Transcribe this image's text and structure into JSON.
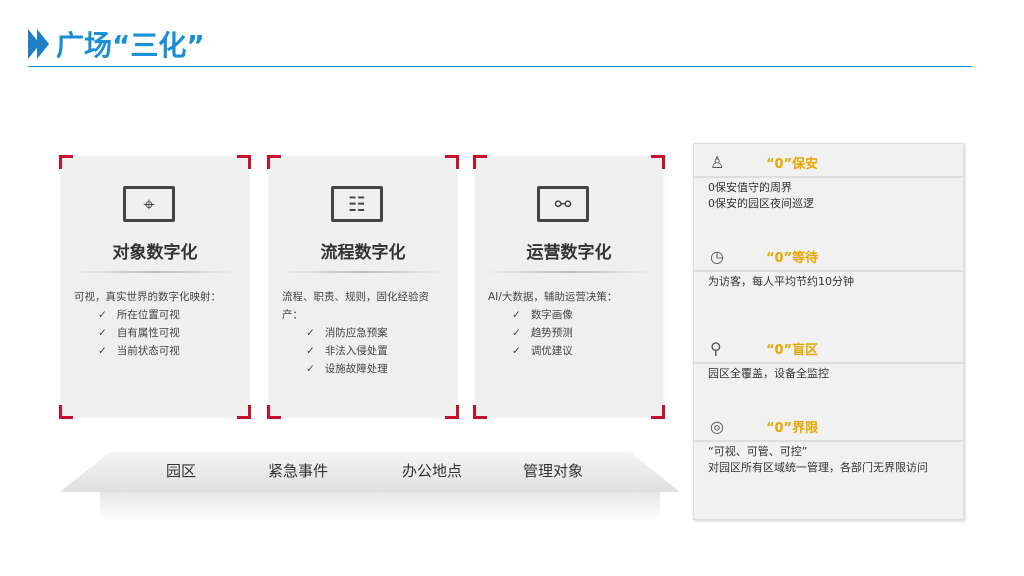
{
  "header": {
    "title": "广场“三化”"
  },
  "cards": [
    {
      "title": "对象数字化",
      "icon": "target-icon",
      "desc": "可视，真实世界的数字化映射：",
      "items": [
        "所在位置可视",
        "自有属性可视",
        "当前状态可视"
      ]
    },
    {
      "title": "流程数字化",
      "icon": "flowchart-icon",
      "desc": "流程、职责、规则，固化经验资产：",
      "items": [
        "消防应急预案",
        "非法入侵处置",
        "设施故障处理"
      ]
    },
    {
      "title": "运营数字化",
      "icon": "network-icon",
      "desc": "AI/大数据，辅助运营决策：",
      "items": [
        "数字画像",
        "趋势预测",
        "调优建议"
      ]
    }
  ],
  "check": "✓",
  "platform": [
    "园区",
    "紧急事件",
    "办公地点",
    "管理对象"
  ],
  "panel": [
    {
      "icon": "security-guard-icon",
      "title": "“0”保安",
      "lines": [
        "0保安值守的周界",
        "0保安的园区夜间巡逻"
      ]
    },
    {
      "icon": "clock-icon",
      "title": "“0”等待",
      "lines": [
        "为访客，每人平均节约10分钟"
      ]
    },
    {
      "icon": "map-pin-icon",
      "title": "“0”盲区",
      "lines": [
        "园区全覆盖，设备全监控"
      ]
    },
    {
      "icon": "radar-icon",
      "title": "“0”界限",
      "lines": [
        "“可视、可管、可控”",
        "对园区所有区域统一管理，各部门无界限访问"
      ]
    }
  ],
  "colors": {
    "accent": "#1a8fd6",
    "corner": "#c8102e",
    "highlight": "#e6a800"
  }
}
